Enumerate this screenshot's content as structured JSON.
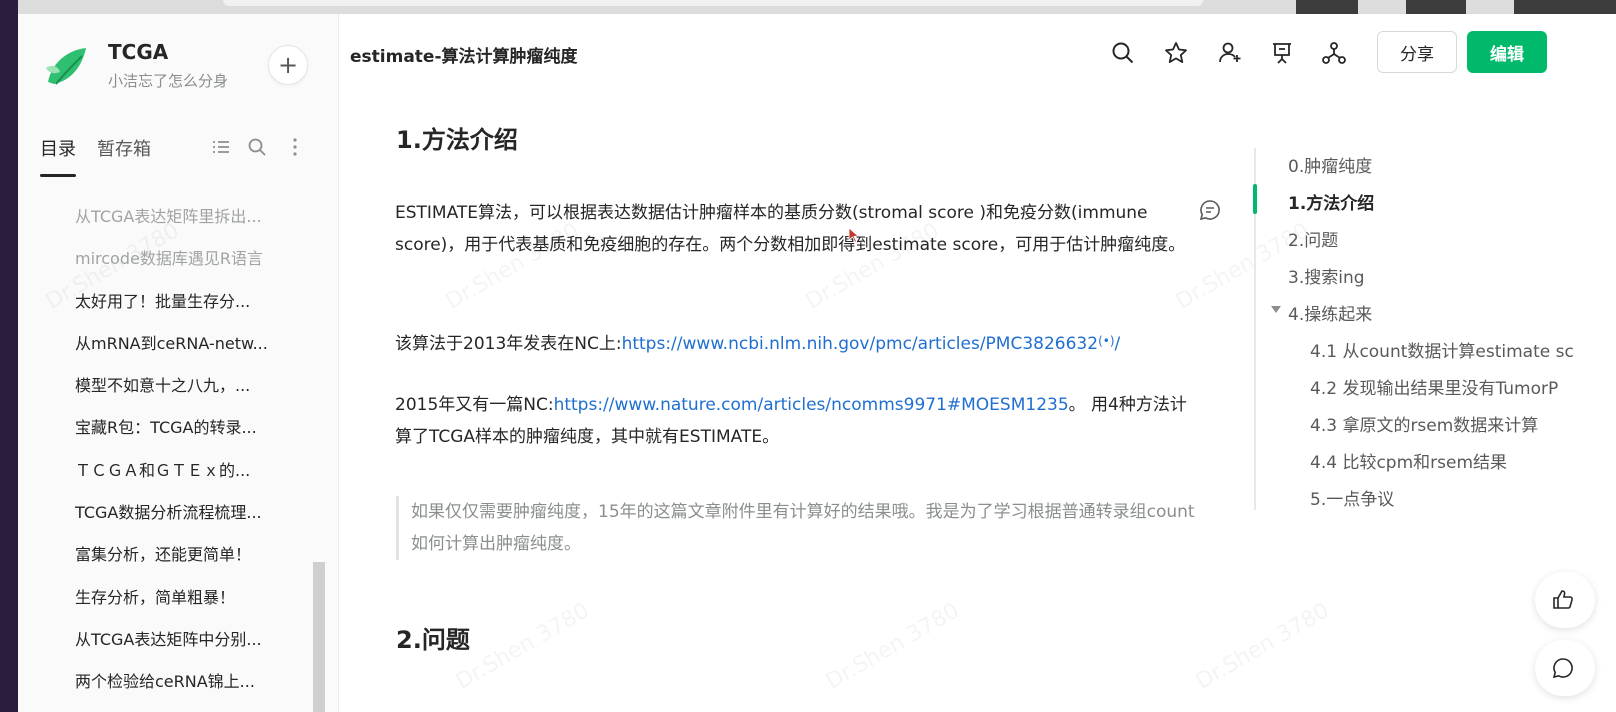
{
  "book": {
    "title": "TCGA",
    "author": "小洁忘了怎么分身"
  },
  "sidebar": {
    "tabs": [
      "目录",
      "暂存箱"
    ],
    "items": [
      "从TCGA表达矩阵里拆出...",
      "mircode数据库遇见R语言",
      "太好用了！批量生存分...",
      "从mRNA到ceRNA-netw...",
      "模型不如意十之八九，...",
      "宝藏R包：TCGA的转录...",
      "ＴＣＧＡ和ＧＴＥｘ的...",
      "TCGA数据分析流程梳理...",
      "富集分析，还能更简单！",
      "生存分析，简单粗暴！",
      "从TCGA表达矩阵中分别...",
      "两个检验给ceRNA锦上..."
    ]
  },
  "header": {
    "doc_title": "estimate-算法计算肿瘤纯度",
    "share_label": "分享",
    "edit_label": "编辑"
  },
  "content": {
    "h1_method": "1.方法介绍",
    "p1": "ESTIMATE算法，可以根据表达数据估计肿瘤样本的基质分数(stromal score )和免疫分数(immune score)，用于代表基质和免疫细胞的存在。两个分数相加即得到estimate score，可用于估计肿瘤纯度。",
    "p2_prefix": "该算法于2013年发表在NC上:",
    "p2_link": "https://www.ncbi.nlm.nih.gov/pmc/articles/PMC3826632",
    "p2_link_tail": "/",
    "p3_prefix": "2015年又有一篇NC:",
    "p3_link": "https://www.nature.com/articles/ncomms9971#MOESM1235",
    "p3_suffix": "。 用4种方法计算了TCGA样本的肿瘤纯度，其中就有ESTIMATE。",
    "quote": "如果仅仅需要肿瘤纯度，15年的这篇文章附件里有计算好的结果哦。我是为了学习根据普通转录组count如何计算出肿瘤纯度。",
    "h1_problem": "2.问题"
  },
  "outline": [
    "0.肿瘤纯度",
    "1.方法介绍",
    "2.问题",
    "3.搜索ing",
    "4.操练起来",
    "4.1 从count数据计算estimate sc",
    "4.2 发现输出结果里没有TumorP",
    "4.3 拿原文的rsem数据来计算",
    "4.4 比较cpm和rsem结果",
    "5.一点争议"
  ],
  "watermark": "Dr.Shen 3780",
  "colors": {
    "accent": "#00b96b",
    "link": "#1f6fd1"
  }
}
